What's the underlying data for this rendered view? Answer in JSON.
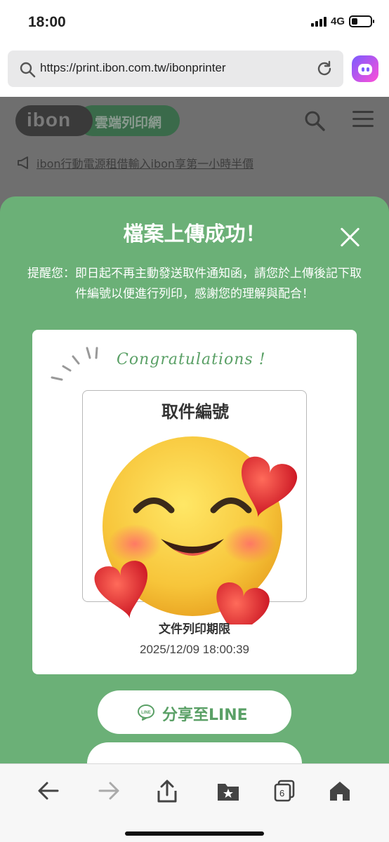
{
  "status_bar": {
    "time": "18:00",
    "network": "4G"
  },
  "browser": {
    "url": "https://print.ibon.com.tw/ibonprinter"
  },
  "site": {
    "logo": "ibon",
    "tagline": "雲端列印網",
    "promo": "ibon行動電源租借輸入ibon享第一小時半價"
  },
  "modal": {
    "title": "檔案上傳成功！",
    "notice": "提醒您：即日起不再主動發送取件通知函，請您於上傳後記下取件編號以便進行列印，感謝您的理解與配合！",
    "congrats": "Congratulations !",
    "pickup_title": "取件編號",
    "pickup_code": "",
    "deadline_label": "文件列印期限",
    "deadline_value": "2025/12/09 18:00:39",
    "share_button": "分享至LINE"
  },
  "toolbar": {
    "tab_count": "6"
  },
  "colors": {
    "accent_green": "#6bb077",
    "text_green": "#5aa066"
  },
  "icons": [
    "search-icon",
    "reload-icon",
    "assistant-icon",
    "close-icon",
    "line-icon",
    "back-icon",
    "forward-icon",
    "share-icon",
    "bookmarks-icon",
    "tabs-icon",
    "home-icon",
    "emoji-sticker"
  ]
}
